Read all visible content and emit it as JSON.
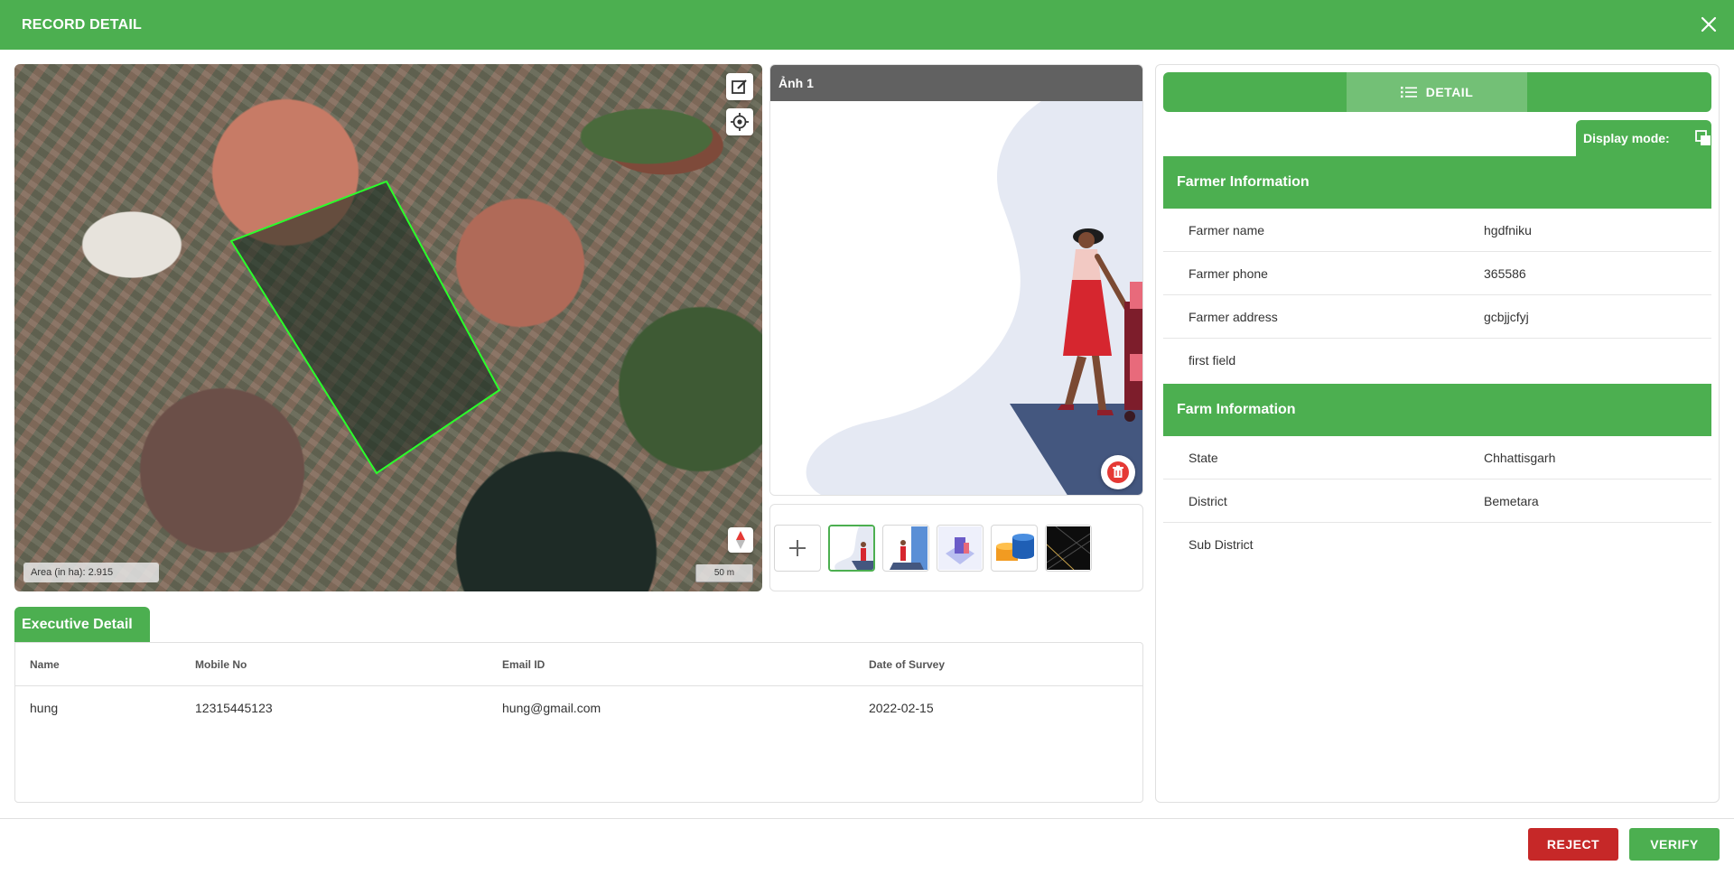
{
  "header": {
    "title": "RECORD DETAIL"
  },
  "map": {
    "area_label": "Area (in ha): 2.915",
    "scale_label": "50 m"
  },
  "viewer": {
    "title": "Ảnh 1"
  },
  "executive": {
    "tab_label": "Executive Detail",
    "columns": [
      "Name",
      "Mobile No",
      "Email ID",
      "Date of Survey"
    ],
    "rows": [
      [
        "hung",
        "12315445123",
        "hung@gmail.com",
        "2022-02-15"
      ]
    ]
  },
  "detail": {
    "tab_label": "DETAIL",
    "display_mode_label": "Display mode:",
    "farmer_section": "Farmer Information",
    "farmer_rows": [
      {
        "label": "Farmer name",
        "value": "hgdfniku"
      },
      {
        "label": "Farmer phone",
        "value": "365586"
      },
      {
        "label": "Farmer address",
        "value": "gcbjjcfyj"
      },
      {
        "label": "first field",
        "value": ""
      }
    ],
    "farm_section": "Farm Information",
    "farm_rows": [
      {
        "label": "State",
        "value": "Chhattisgarh"
      },
      {
        "label": "District",
        "value": "Bemetara"
      },
      {
        "label": "Sub District",
        "value": ""
      }
    ]
  },
  "footer": {
    "reject_label": "REJECT",
    "verify_label": "VERIFY"
  },
  "colors": {
    "primary": "#4caf50",
    "danger": "#c62828",
    "viewer_header": "#616161"
  }
}
